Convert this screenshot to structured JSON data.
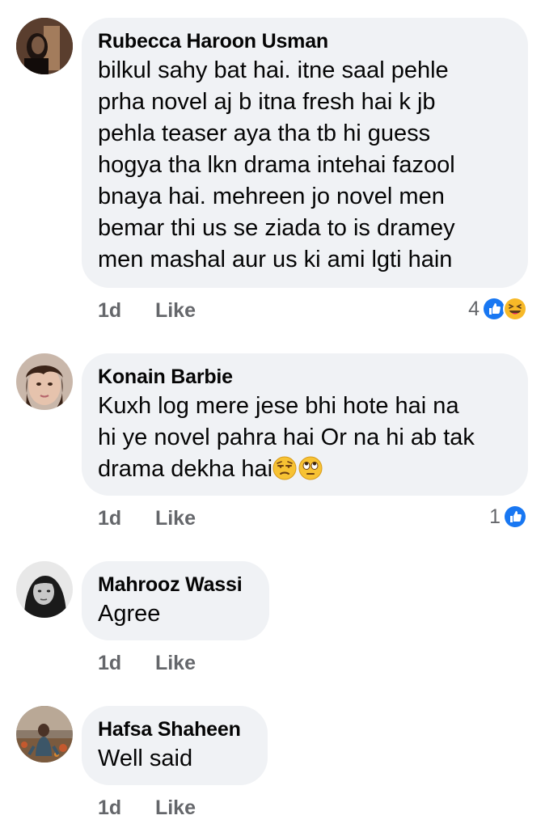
{
  "comments": [
    {
      "author": "Rubecca Haroon Usman",
      "text": "bilkul sahy bat hai. itne saal pehle\nprha novel aj b itna fresh hai k jb\npehla teaser aya tha tb hi guess\nhogya tha lkn drama intehai fazool\nbnaya hai. mehreen jo novel men\nbemar thi us se ziada to is dramey\nmen mashal aur us ki ami lgti hain",
      "time": "1d",
      "like_label": "Like",
      "reaction_count": "4",
      "reactions": [
        "like-reaction-icon",
        "haha-reaction-icon"
      ]
    },
    {
      "author": "Konain Barbie",
      "text": "Kuxh log mere jese bhi hote hai na\nhi ye novel pahra hai Or na hi ab tak\ndrama dekha hai",
      "text_emojis": [
        "unamused-face-emoji",
        "eye-roll-emoji"
      ],
      "time": "1d",
      "like_label": "Like",
      "reaction_count": "1",
      "reactions": [
        "like-reaction-icon"
      ]
    },
    {
      "author": "Mahrooz Wassi",
      "text": "Agree",
      "time": "1d",
      "like_label": "Like"
    },
    {
      "author": "Hafsa Shaheen",
      "text": "Well said",
      "time": "1d",
      "like_label": "Like"
    }
  ],
  "colors": {
    "bubble": "#f0f2f5",
    "meta_text": "#65676b",
    "like_blue": "#1877f2",
    "haha_yellow": "#f7b928"
  }
}
